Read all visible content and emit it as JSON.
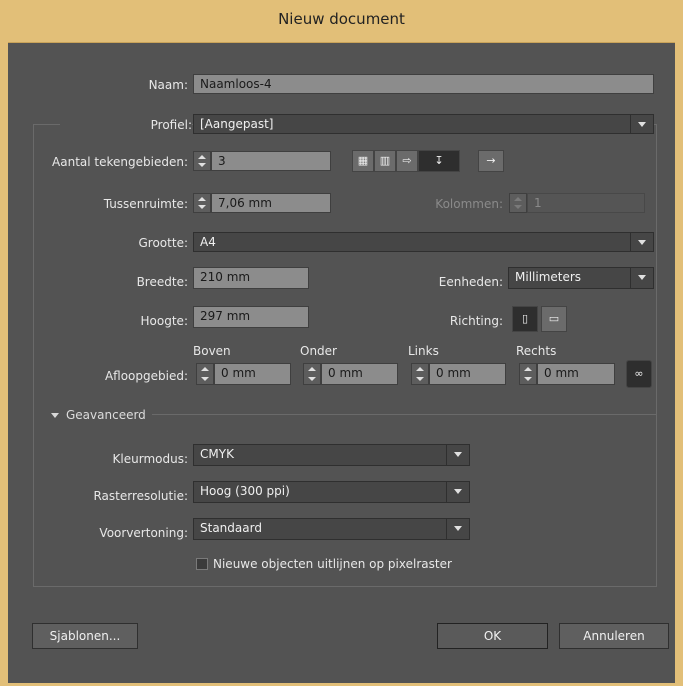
{
  "window": {
    "title": "Nieuw document"
  },
  "naam": {
    "label": "Naam:",
    "value": "Naamloos-4"
  },
  "profiel": {
    "label": "Profiel:",
    "value": "[Aangepast]"
  },
  "aantal": {
    "label": "Aantal tekengebieden:",
    "value": "3"
  },
  "tussenruimte": {
    "label": "Tussenruimte:",
    "value": "7,06 mm"
  },
  "kolommen": {
    "label": "Kolommen:",
    "value": "1"
  },
  "grootte": {
    "label": "Grootte:",
    "value": "A4"
  },
  "breedte": {
    "label": "Breedte:",
    "value": "210 mm"
  },
  "hoogte": {
    "label": "Hoogte:",
    "value": "297 mm"
  },
  "eenheden": {
    "label": "Eenheden:",
    "value": "Millimeters"
  },
  "richting": {
    "label": "Richting:"
  },
  "afloop": {
    "label": "Afloopgebied:",
    "boven": {
      "label": "Boven",
      "value": "0 mm"
    },
    "onder": {
      "label": "Onder",
      "value": "0 mm"
    },
    "links": {
      "label": "Links",
      "value": "0 mm"
    },
    "rechts": {
      "label": "Rechts",
      "value": "0 mm"
    }
  },
  "geavanceerd": {
    "label": "Geavanceerd"
  },
  "kleurmodus": {
    "label": "Kleurmodus:",
    "value": "CMYK"
  },
  "raster": {
    "label": "Rasterresolutie:",
    "value": "Hoog (300 ppi)"
  },
  "voorvertoning": {
    "label": "Voorvertoning:",
    "value": "Standaard"
  },
  "uitlijnen": {
    "label": "Nieuwe objecten uitlijnen op pixelraster",
    "checked": false
  },
  "buttons": {
    "sjablonen": "Sjablonen...",
    "ok": "OK",
    "annuleren": "Annuleren"
  },
  "icons": [
    "grid-by-row-icon",
    "grid-by-column-icon",
    "arrange-by-row-icon",
    "arrange-by-column-icon",
    "ltr-layout-icon",
    "portrait-icon",
    "landscape-icon",
    "link-icon"
  ],
  "colors": {
    "titlebar": "#e2bf78",
    "background": "#535353",
    "field": "#8c8c8c"
  }
}
